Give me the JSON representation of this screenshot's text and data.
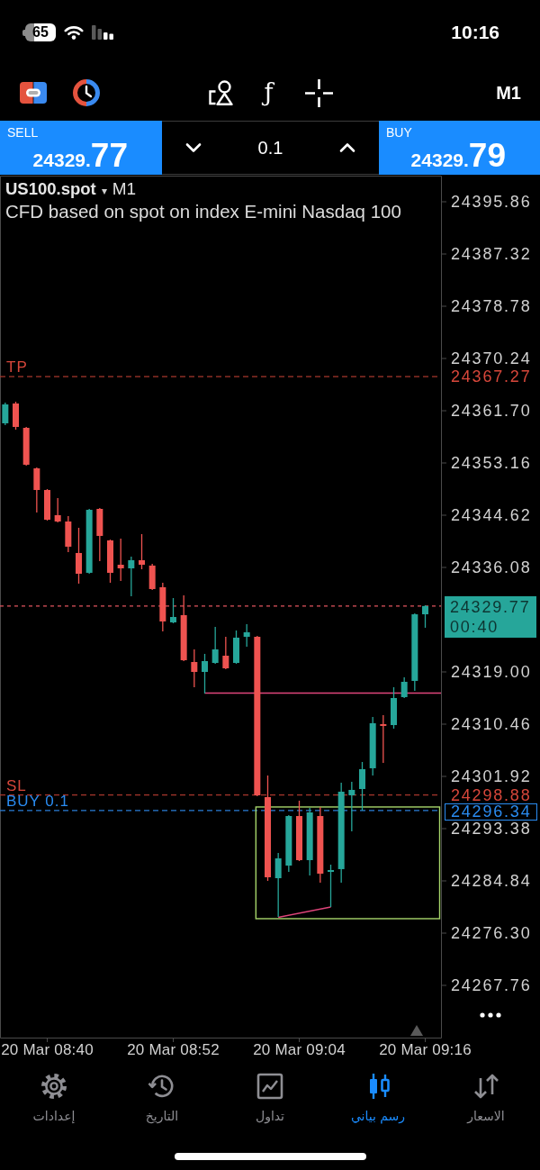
{
  "status_bar": {
    "battery": "65",
    "time": "10:16"
  },
  "toolbar": {
    "function_symbol": "ƒ",
    "timeframe": "M1"
  },
  "trade_panel": {
    "sell": {
      "label": "SELL",
      "price_head": "24329.",
      "price_tail": "77"
    },
    "volume": "0.1",
    "buy": {
      "label": "BUY",
      "price_head": "24329.",
      "price_tail": "79"
    }
  },
  "chart": {
    "symbol": "US100.spot",
    "caret": "▾",
    "timeframe": "M1",
    "description": "CFD based on spot on index E-mini Nasdaq 100",
    "chart_data": {
      "type": "candlestick",
      "categories": [
        null,
        null,
        null,
        null,
        "20 Mar 08:40",
        null,
        null,
        null,
        null,
        null,
        null,
        null,
        null,
        null,
        null,
        null,
        "20 Mar 08:52",
        null,
        null,
        null,
        null,
        null,
        null,
        null,
        null,
        null,
        null,
        null,
        "20 Mar 09:04",
        null,
        null,
        null,
        null,
        null,
        null,
        null,
        null,
        null,
        null,
        null,
        "20 Mar 09:16",
        null
      ],
      "ohlc": [
        [
          24359.64,
          24363.03,
          24359.34,
          24362.73
        ],
        [
          24362.88,
          24363.17,
          24358.61,
          24359.05
        ],
        [
          24358.9,
          24359.05,
          24352.72,
          24352.87
        ],
        [
          24352.28,
          24352.42,
          24345.06,
          24348.74
        ],
        [
          24348.74,
          24348.89,
          24343.74,
          24343.88
        ],
        [
          24344.62,
          24347.42,
          24343.44,
          24343.59
        ],
        [
          24343.59,
          24344.47,
          24338.58,
          24339.47
        ],
        [
          24338.44,
          24342.56,
          24333.43,
          24335.05
        ],
        [
          24335.2,
          24345.65,
          24335.05,
          24345.5
        ],
        [
          24345.65,
          24345.8,
          24337.11,
          24341.23
        ],
        [
          24340.5,
          24340.64,
          24333.58,
          24335.2
        ],
        [
          24336.52,
          24340.79,
          24333.87,
          24335.93
        ],
        [
          24335.93,
          24337.85,
          24331.37,
          24337.26
        ],
        [
          24337.26,
          24341.53,
          24335.79,
          24336.52
        ],
        [
          24336.38,
          24336.67,
          24332.4,
          24332.55
        ],
        [
          24332.84,
          24333.58,
          24325.63,
          24327.25
        ],
        [
          24327.1,
          24331.07,
          24326.95,
          24327.98
        ],
        [
          24328.28,
          24331.52,
          24320.77,
          24320.91
        ],
        [
          24320.62,
          24322.68,
          24316.5,
          24319.0
        ],
        [
          24319.0,
          24321.95,
          24315.47,
          24320.77
        ],
        [
          24320.47,
          24326.36,
          24320.33,
          24322.68
        ],
        [
          24321.65,
          24324.74,
          24319.44,
          24319.59
        ],
        [
          24320.47,
          24325.77,
          24320.33,
          24324.6
        ],
        [
          24324.74,
          24326.8,
          24323.12,
          24325.48
        ],
        [
          24324.74,
          24324.89,
          24298.68,
          24298.83
        ],
        [
          24298.53,
          24302.07,
          24284.84,
          24285.43
        ],
        [
          24285.28,
          24289.41,
          24278.95,
          24288.52
        ],
        [
          24287.34,
          24295.59,
          24286.31,
          24295.44
        ],
        [
          24295.44,
          24297.95,
          24288.08,
          24288.23
        ],
        [
          24288.23,
          24296.77,
          24285.72,
          24296.03
        ],
        [
          24295.44,
          24296.91,
          24284.55,
          24286.02
        ],
        [
          24286.31,
          24287.49,
          24280.57,
          24286.61
        ],
        [
          24286.76,
          24300.89,
          24284.55,
          24299.42
        ],
        [
          24298.83,
          24301.04,
          24292.94,
          24299.71
        ],
        [
          24299.86,
          24304.28,
          24296.33,
          24303.1
        ],
        [
          24303.25,
          24311.64,
          24302.07,
          24310.61
        ],
        [
          24310.46,
          24311.93,
          24304.13,
          24310.17
        ],
        [
          24310.31,
          24316.5,
          24309.72,
          24314.73
        ],
        [
          24314.88,
          24318.12,
          24314.73,
          24317.38
        ],
        [
          24317.53,
          24328.57,
          24315.91,
          24328.42
        ],
        [
          24328.42,
          24329.9,
          24326.22,
          24329.77
        ],
        null
      ],
      "ylim": [
        24259.22,
        24400.13
      ],
      "yticks": [
        {
          "value": 24395.86,
          "label": "24395.86"
        },
        {
          "value": 24387.32,
          "label": "24387.32"
        },
        {
          "value": 24378.78,
          "label": "24378.78"
        },
        {
          "value": 24370.24,
          "label": "24370.24"
        },
        {
          "value": 24361.7,
          "label": "24361.70"
        },
        {
          "value": 24353.16,
          "label": "24353.16"
        },
        {
          "value": 24344.62,
          "label": "24344.62"
        },
        {
          "value": 24336.08,
          "label": "24336.08"
        },
        {
          "value": 24319,
          "label": "24319.00"
        },
        {
          "value": 24310.46,
          "label": "24310.46"
        },
        {
          "value": 24301.92,
          "label": "24301.92"
        },
        {
          "value": 24293.38,
          "label": "24293.38"
        },
        {
          "value": 24284.84,
          "label": "24284.84"
        },
        {
          "value": 24276.3,
          "label": "24276.30"
        },
        {
          "value": 24267.76,
          "label": "24267.76"
        }
      ]
    },
    "levels": [
      {
        "kind": "take_profit",
        "label": "TP",
        "price": "24367.27"
      },
      {
        "kind": "market",
        "price": "24329.77",
        "countdown": "00:40"
      },
      {
        "kind": "stop_loss",
        "label": "SL",
        "price": "24298.88"
      },
      {
        "kind": "order",
        "label": "BUY 0.1",
        "price": "24296.34"
      }
    ]
  },
  "tab_bar": {
    "tabs": [
      {
        "label": "الاسعار",
        "selected": false
      },
      {
        "label": "رسم بياني",
        "selected": true
      },
      {
        "label": "تداول",
        "selected": false
      },
      {
        "label": "التاريخ",
        "selected": false
      },
      {
        "label": "إعدادات",
        "selected": false
      }
    ]
  }
}
